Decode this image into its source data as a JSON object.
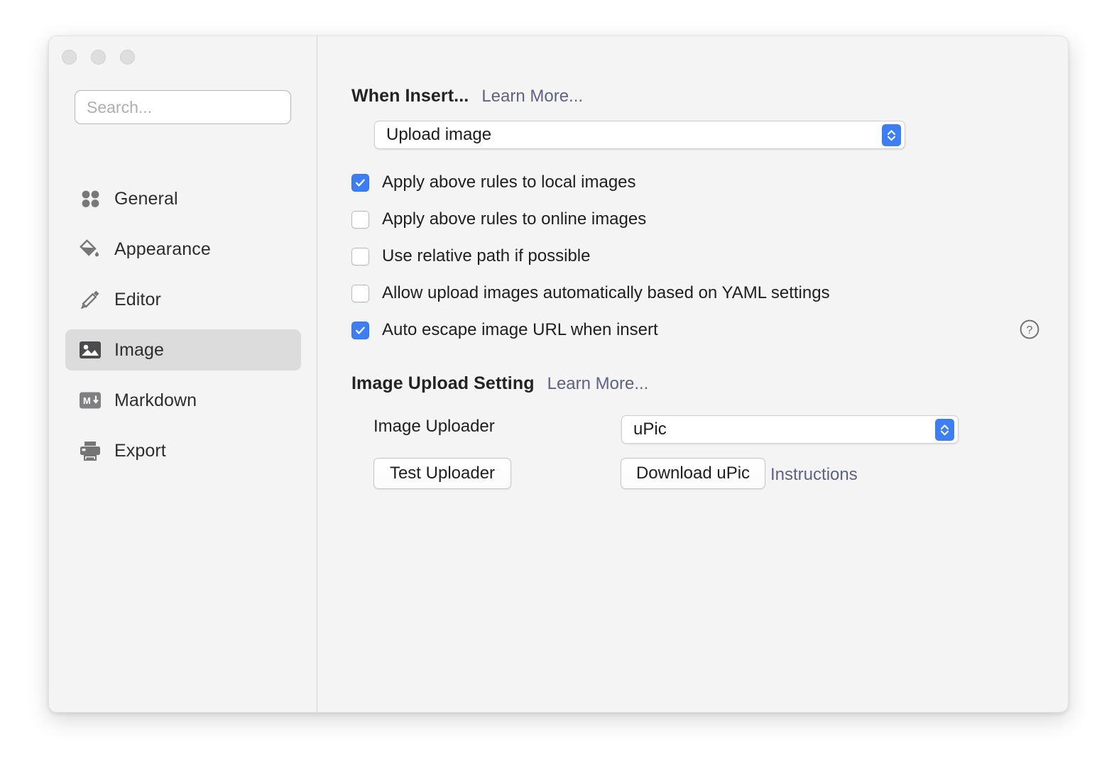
{
  "window": {
    "traffic_lights": [
      "close-button",
      "minimize-button",
      "zoom-button"
    ]
  },
  "sidebar": {
    "search": {
      "value": "",
      "placeholder": "Search..."
    },
    "items": [
      {
        "label": "General",
        "icon": "grid-dots-icon",
        "selected": false
      },
      {
        "label": "Appearance",
        "icon": "paint-bucket-icon",
        "selected": false
      },
      {
        "label": "Editor",
        "icon": "pencil-icon",
        "selected": false
      },
      {
        "label": "Image",
        "icon": "image-icon",
        "selected": true
      },
      {
        "label": "Markdown",
        "icon": "markdown-icon",
        "selected": false
      },
      {
        "label": "Export",
        "icon": "printer-icon",
        "selected": false
      }
    ]
  },
  "main": {
    "when_insert": {
      "title": "When Insert...",
      "learn_more": "Learn More...",
      "dropdown": {
        "value": "Upload image",
        "options": [
          "Upload image"
        ]
      },
      "checkboxes": [
        {
          "label": "Apply above rules to local images",
          "checked": true
        },
        {
          "label": "Apply above rules to online images",
          "checked": false
        },
        {
          "label": "Use relative path if possible",
          "checked": false
        },
        {
          "label": "Allow upload images automatically based on YAML settings",
          "checked": false
        },
        {
          "label": "Auto escape image URL when insert",
          "checked": true
        }
      ],
      "help_icon": "question-circle-icon"
    },
    "image_upload_setting": {
      "title": "Image Upload Setting",
      "learn_more": "Learn More...",
      "uploader_label": "Image Uploader",
      "uploader_dropdown": {
        "value": "uPic",
        "options": [
          "uPic"
        ]
      },
      "test_uploader_button": "Test Uploader",
      "download_button": "Download uPic",
      "instructions_link": "Instructions"
    }
  },
  "colors": {
    "accent_blue": "#3d7ef4",
    "link_purple": "#5f6185",
    "window_bg": "#f4f4f4",
    "selected_row": "#dcdcdd",
    "text_primary": "#1f1f21"
  }
}
